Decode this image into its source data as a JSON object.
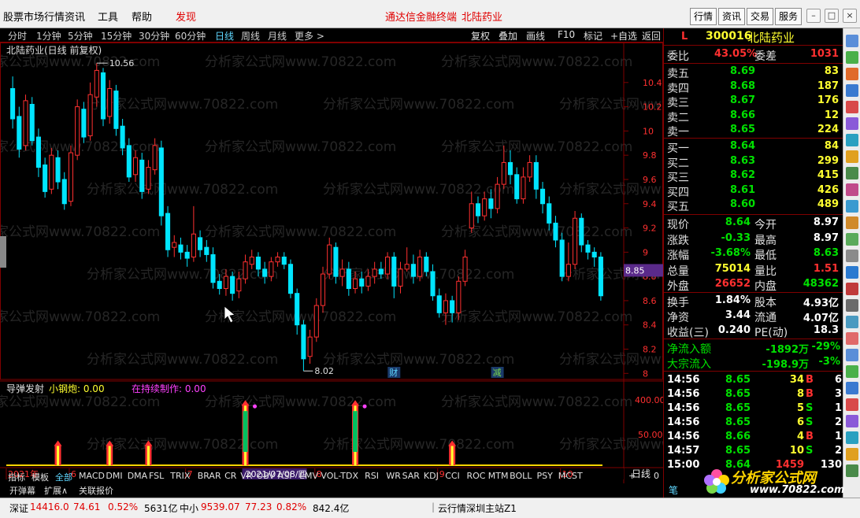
{
  "menubar": {
    "items": [
      {
        "label": "股票市场行情",
        "x": 0
      },
      {
        "label": "资讯",
        "x": 82
      },
      {
        "label": "工具",
        "x": 124
      },
      {
        "label": "帮助",
        "x": 167
      },
      {
        "label": "发现",
        "x": 223,
        "hot": true
      }
    ],
    "center_title": "通达信金融终端",
    "center_stock": "北陆药业",
    "tabs": [
      "行情",
      "资讯",
      "交易",
      "服务"
    ]
  },
  "periods": {
    "items": [
      "分时",
      "1分钟",
      "5分钟",
      "15分钟",
      "30分钟",
      "60分钟",
      "日线",
      "周线",
      "月线",
      "更多 >"
    ],
    "selected": "日线"
  },
  "chart_tools": [
    "复权",
    "叠加",
    "画线",
    "F10",
    "标记",
    "+自选",
    "返回"
  ],
  "chart_title": "北陆药业(日线 前复权)",
  "watermark": "分析家公式网www.70822.com",
  "chart_data": {
    "type": "candlestick",
    "price_axis": [
      10.4,
      10.2,
      10.0,
      9.8,
      9.6,
      9.4,
      9.2,
      9.0,
      8.8,
      8.6,
      8.4,
      8.2,
      8.0
    ],
    "high_label": "10.56",
    "low_label": "8.02",
    "current_price_tag": "8.85",
    "x_ticks": [
      {
        "label": "2021年",
        "i": 0
      },
      {
        "label": "6",
        "i": 9
      },
      {
        "label": "7",
        "i": 27
      },
      {
        "label": "2021/07/08/四",
        "i": 36
      },
      {
        "label": "8",
        "i": 47
      },
      {
        "label": "9",
        "i": 66
      },
      {
        "label": "10",
        "i": 85
      }
    ],
    "event_markers": [
      {
        "label": "财",
        "i": 59
      },
      {
        "label": "减",
        "i": 75
      }
    ],
    "candles": [
      [
        10.35,
        10.1,
        10.45,
        10.02
      ],
      [
        10.12,
        9.85,
        10.2,
        9.78
      ],
      [
        9.88,
        10.25,
        10.3,
        9.84
      ],
      [
        10.22,
        9.92,
        10.28,
        9.88
      ],
      [
        9.95,
        9.7,
        10.02,
        9.62
      ],
      [
        9.72,
        9.5,
        9.78,
        9.45
      ],
      [
        9.52,
        9.8,
        9.86,
        9.48
      ],
      [
        9.78,
        9.58,
        9.84,
        9.52
      ],
      [
        9.6,
        9.4,
        9.66,
        9.35
      ],
      [
        9.42,
        9.82,
        9.88,
        9.38
      ],
      [
        9.8,
        10.2,
        10.26,
        9.76
      ],
      [
        10.18,
        9.95,
        10.24,
        9.9
      ],
      [
        9.96,
        10.3,
        10.4,
        9.92
      ],
      [
        10.28,
        10.5,
        10.56,
        10.2
      ],
      [
        10.48,
        10.1,
        10.52,
        10.04
      ],
      [
        10.12,
        10.35,
        10.42,
        10.06
      ],
      [
        10.33,
        10.02,
        10.38,
        9.96
      ],
      [
        10.04,
        9.86,
        10.1,
        9.8
      ],
      [
        9.88,
        9.62,
        9.94,
        9.58
      ],
      [
        9.64,
        9.78,
        9.84,
        9.58
      ],
      [
        9.76,
        9.5,
        9.82,
        9.44
      ],
      [
        9.52,
        9.7,
        9.76,
        9.48
      ],
      [
        9.68,
        9.88,
        9.94,
        9.64
      ],
      [
        9.86,
        9.3,
        9.92,
        9.22
      ],
      [
        9.32,
        9.02,
        9.38,
        8.96
      ],
      [
        9.04,
        9.08,
        9.14,
        8.96
      ],
      [
        9.06,
        9.0,
        9.12,
        8.94
      ],
      [
        9.0,
        8.95,
        9.06,
        8.88
      ],
      [
        8.96,
        9.15,
        9.38,
        8.92
      ],
      [
        9.12,
        9.02,
        9.18,
        8.96
      ],
      [
        9.04,
        8.98,
        9.1,
        8.92
      ],
      [
        8.98,
        8.75,
        9.04,
        8.7
      ],
      [
        8.76,
        8.7,
        8.82,
        8.65
      ],
      [
        8.7,
        8.8,
        8.86,
        8.64
      ],
      [
        8.8,
        8.66,
        8.84,
        8.6
      ],
      [
        8.68,
        8.78,
        8.84,
        8.62
      ],
      [
        8.78,
        8.92,
        8.98,
        8.74
      ],
      [
        8.9,
        8.96,
        9.02,
        8.86
      ],
      [
        8.96,
        8.86,
        9.0,
        8.8
      ],
      [
        8.86,
        8.8,
        8.92,
        8.74
      ],
      [
        8.8,
        8.92,
        8.96,
        8.76
      ],
      [
        8.92,
        8.96,
        9.0,
        8.88
      ],
      [
        8.96,
        8.9,
        9.0,
        8.86
      ],
      [
        8.9,
        8.66,
        8.94,
        8.62
      ],
      [
        8.66,
        8.4,
        8.7,
        8.32
      ],
      [
        8.4,
        8.12,
        8.44,
        8.02
      ],
      [
        8.14,
        8.3,
        8.36,
        8.08
      ],
      [
        8.3,
        8.56,
        8.62,
        8.26
      ],
      [
        8.56,
        8.82,
        8.88,
        8.5
      ],
      [
        8.82,
        9.06,
        9.12,
        8.78
      ],
      [
        9.04,
        8.8,
        9.08,
        8.74
      ],
      [
        8.8,
        8.86,
        8.94,
        8.72
      ],
      [
        8.86,
        8.7,
        8.92,
        8.64
      ],
      [
        8.7,
        8.78,
        8.84,
        8.66
      ],
      [
        8.78,
        8.72,
        8.84,
        8.66
      ],
      [
        8.72,
        8.8,
        8.86,
        8.68
      ],
      [
        8.8,
        8.86,
        8.92,
        8.74
      ],
      [
        8.86,
        8.82,
        8.92,
        8.78
      ],
      [
        8.82,
        8.96,
        9.0,
        8.78
      ],
      [
        8.96,
        8.72,
        9.0,
        8.62
      ],
      [
        8.72,
        8.86,
        8.92,
        8.66
      ],
      [
        8.86,
        8.9,
        9.04,
        8.84
      ],
      [
        8.9,
        8.8,
        8.98,
        8.74
      ],
      [
        8.8,
        8.96,
        9.02,
        8.76
      ],
      [
        8.96,
        8.84,
        9.0,
        8.8
      ],
      [
        8.84,
        8.64,
        8.9,
        8.6
      ],
      [
        8.64,
        8.5,
        8.7,
        8.46
      ],
      [
        8.5,
        8.6,
        8.66,
        8.4
      ],
      [
        8.6,
        8.5,
        8.64,
        8.42
      ],
      [
        8.5,
        8.76,
        8.8,
        8.44
      ],
      [
        8.76,
        8.96,
        9.02,
        8.72
      ],
      [
        9.2,
        9.4,
        9.5,
        9.16
      ],
      [
        9.4,
        9.3,
        9.46,
        9.24
      ],
      [
        9.3,
        9.44,
        9.5,
        9.26
      ],
      [
        9.44,
        9.36,
        9.52,
        9.28
      ],
      [
        9.36,
        9.56,
        9.62,
        9.32
      ],
      [
        9.56,
        9.74,
        9.88,
        9.52
      ],
      [
        9.74,
        9.64,
        9.84,
        9.56
      ],
      [
        9.64,
        9.44,
        9.7,
        9.4
      ],
      [
        9.44,
        9.62,
        9.7,
        9.4
      ],
      [
        9.62,
        9.74,
        9.8,
        9.58
      ],
      [
        9.74,
        9.52,
        9.8,
        9.44
      ],
      [
        9.52,
        9.4,
        9.58,
        9.32
      ],
      [
        9.4,
        9.24,
        9.46,
        9.18
      ],
      [
        9.24,
        9.1,
        9.3,
        9.04
      ],
      [
        9.1,
        8.8,
        9.16,
        8.76
      ],
      [
        8.8,
        8.9,
        9.08,
        8.76
      ],
      [
        8.9,
        9.28,
        9.34,
        8.86
      ],
      [
        9.28,
        9.06,
        9.32,
        9.0
      ],
      [
        9.06,
        9.0,
        9.1,
        8.94
      ],
      [
        9.0,
        8.96,
        9.04,
        8.88
      ],
      [
        8.96,
        8.64,
        9.0,
        8.6
      ]
    ],
    "indicator": {
      "title": "导弹发射",
      "line1_label": "小钢炮: 0.00",
      "line2_label": "在持续制作: 0.00",
      "axis": [
        "400.00",
        "50.00"
      ],
      "pulses": [
        {
          "i": 7,
          "h": 0.35
        },
        {
          "i": 15,
          "h": 0.35
        },
        {
          "i": 21,
          "h": 0.35
        },
        {
          "i": 36,
          "h": 0.92
        },
        {
          "i": 53,
          "h": 0.92
        },
        {
          "i": 68,
          "h": 0.35
        }
      ],
      "period_label": "日线"
    }
  },
  "indicator_tabs": {
    "items": [
      "指标",
      "模板",
      "全部",
      "MACD",
      "DMI",
      "DMA",
      "FSL",
      "TRIX",
      "BRAR",
      "CR",
      "VR",
      "OBV",
      "ASI",
      "EMV",
      "VOL-TDX",
      "RSI",
      "WR",
      "SAR",
      "KDJ",
      "CCI",
      "ROC",
      "MTM",
      "BOLL",
      "PSY",
      "MCST"
    ],
    "selected": "全部",
    "controls": [
      "+",
      "-",
      "0"
    ]
  },
  "bottom_tabs": [
    "开弹幕",
    "扩展∧",
    "关联报价"
  ],
  "quote": {
    "marker": "L",
    "code": "300016",
    "name": "北陆药业",
    "weibi_label": "委比",
    "weibi": "43.05%",
    "weicha_label": "委差",
    "weicha": "1031",
    "asks": [
      {
        "label": "卖五",
        "price": "8.69",
        "vol": "83"
      },
      {
        "label": "卖四",
        "price": "8.68",
        "vol": "187"
      },
      {
        "label": "卖三",
        "price": "8.67",
        "vol": "176"
      },
      {
        "label": "卖二",
        "price": "8.66",
        "vol": "12"
      },
      {
        "label": "卖一",
        "price": "8.65",
        "vol": "224"
      }
    ],
    "bids": [
      {
        "label": "买一",
        "price": "8.64",
        "vol": "84"
      },
      {
        "label": "买二",
        "price": "8.63",
        "vol": "299"
      },
      {
        "label": "买三",
        "price": "8.62",
        "vol": "415"
      },
      {
        "label": "买四",
        "price": "8.61",
        "vol": "426"
      },
      {
        "label": "买五",
        "price": "8.60",
        "vol": "489"
      }
    ],
    "stats": [
      {
        "l1": "现价",
        "v1": "8.64",
        "c1": "g",
        "l2": "今开",
        "v2": "8.97",
        "c2": "w"
      },
      {
        "l1": "涨跌",
        "v1": "-0.33",
        "c1": "g",
        "l2": "最高",
        "v2": "8.97",
        "c2": "w"
      },
      {
        "l1": "涨幅",
        "v1": "-3.68%",
        "c1": "g",
        "l2": "最低",
        "v2": "8.63",
        "c2": "g"
      },
      {
        "l1": "总量",
        "v1": "75014",
        "c1": "y",
        "l2": "量比",
        "v2": "1.51",
        "c2": "r"
      },
      {
        "l1": "外盘",
        "v1": "26652",
        "c1": "r",
        "l2": "内盘",
        "v2": "48362",
        "c2": "g"
      }
    ],
    "stats2": [
      {
        "l1": "换手",
        "v1": "1.84%",
        "c1": "w",
        "l2": "股本",
        "v2": "4.93亿",
        "c2": "w"
      },
      {
        "l1": "净资",
        "v1": "3.44",
        "c1": "w",
        "l2": "流通",
        "v2": "4.07亿",
        "c2": "w"
      },
      {
        "l1": "收益(三)",
        "v1": "0.240",
        "c1": "w",
        "l2": "PE(动)",
        "v2": "18.3",
        "c2": "w"
      }
    ],
    "flows": [
      {
        "label": "净流入额",
        "v": "-1892万",
        "p": "-29%"
      },
      {
        "label": "大宗流入",
        "v": "-198.9万",
        "p": "-3%"
      }
    ],
    "ticks": [
      {
        "t": "14:56",
        "p": "8.65",
        "v": "34",
        "s": "B",
        "n": "6"
      },
      {
        "t": "14:56",
        "p": "8.65",
        "v": "8",
        "s": "B",
        "n": "3"
      },
      {
        "t": "14:56",
        "p": "8.65",
        "v": "5",
        "s": "S",
        "n": "1"
      },
      {
        "t": "14:56",
        "p": "8.65",
        "v": "6",
        "s": "S",
        "n": "2"
      },
      {
        "t": "14:56",
        "p": "8.66",
        "v": "4",
        "s": "B",
        "n": "1"
      },
      {
        "t": "14:57",
        "p": "8.65",
        "v": "10",
        "s": "S",
        "n": "2"
      },
      {
        "t": "15:00",
        "p": "8.64",
        "v": "1459",
        "s": "",
        "n": "130"
      }
    ],
    "bottom_label": "笔"
  },
  "statusbar": {
    "items": [
      {
        "text": "深证",
        "c": "#000",
        "x": 12
      },
      {
        "text": "14416.0",
        "c": "#e00000",
        "x": 38
      },
      {
        "text": "74.61",
        "c": "#e00000",
        "x": 93
      },
      {
        "text": "0.52%",
        "c": "#e00000",
        "x": 137
      },
      {
        "text": "5631亿",
        "c": "#000",
        "x": 183
      },
      {
        "text": "中小",
        "c": "#000",
        "x": 228
      },
      {
        "text": "9539.07",
        "c": "#e00000",
        "x": 255
      },
      {
        "text": "77.23",
        "c": "#e00000",
        "x": 311
      },
      {
        "text": "0.82%",
        "c": "#e00000",
        "x": 351
      },
      {
        "text": "842.4亿",
        "c": "#000",
        "x": 397
      },
      {
        "text": "云行情深圳主站Z1",
        "c": "#000",
        "x": 556
      }
    ]
  },
  "logo": {
    "text": "分析家公式网",
    "url": "www.70822.com"
  },
  "colors": {
    "up": "#ff3030",
    "down": "#00e5ff",
    "grid": "#800000",
    "axis_text": "#ff3030"
  }
}
